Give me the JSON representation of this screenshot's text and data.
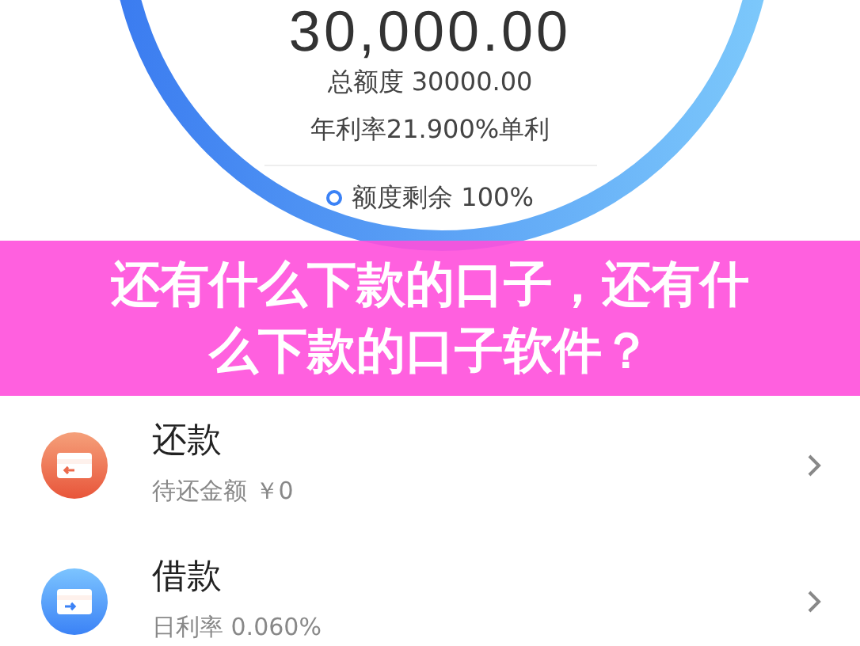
{
  "credit": {
    "available_amount": "30,000.00",
    "total_limit": "总额度 30000.00",
    "annual_rate": "年利率21.900%单利",
    "remaining": "额度剩余 100%"
  },
  "banner": {
    "title": "还有什么下款的口子，还有什么下款的口子软件？"
  },
  "actions": [
    {
      "kind": "repay",
      "title": "还款",
      "subtitle": "待还金额 ￥0"
    },
    {
      "kind": "borrow",
      "title": "借款",
      "subtitle": "日利率 0.060%"
    }
  ]
}
